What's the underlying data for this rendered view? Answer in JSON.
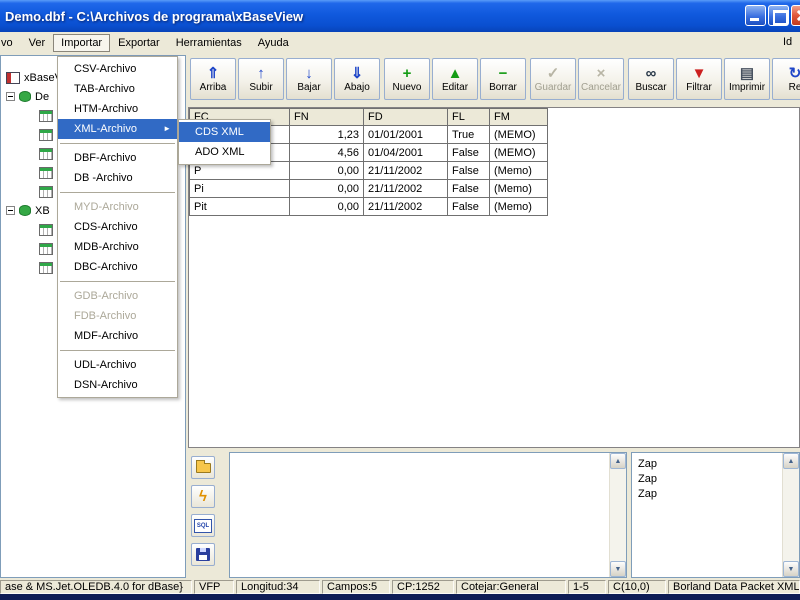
{
  "window": {
    "title": "Demo.dbf - C:\\Archivos de programa\\xBaseView"
  },
  "menubar": {
    "archivo_cut": "vo",
    "ver": "Ver",
    "importar": "Importar",
    "exportar": "Exportar",
    "herramientas": "Herramientas",
    "ayuda": "Ayuda",
    "right_cut": "Id"
  },
  "import_menu": {
    "items": [
      {
        "label": "CSV-Archivo"
      },
      {
        "label": "TAB-Archivo"
      },
      {
        "label": "HTM-Archivo"
      },
      {
        "label": "XML-Archivo"
      },
      {
        "label": "DBF-Archivo"
      },
      {
        "label": "DB -Archivo"
      },
      {
        "label": "MYD-Archivo"
      },
      {
        "label": "CDS-Archivo"
      },
      {
        "label": "MDB-Archivo"
      },
      {
        "label": "DBC-Archivo"
      },
      {
        "label": "GDB-Archivo"
      },
      {
        "label": "FDB-Archivo"
      },
      {
        "label": "MDF-Archivo"
      },
      {
        "label": "UDL-Archivo"
      },
      {
        "label": "DSN-Archivo"
      }
    ],
    "submenu_arrow": "►",
    "xml_submenu": [
      {
        "label": "CDS XML"
      },
      {
        "label": "ADO XML"
      }
    ]
  },
  "tree": {
    "root": "xBaseV",
    "node_demo": "De",
    "node_xb": "XB"
  },
  "toolbar": {
    "buttons": [
      {
        "label": "Arriba",
        "icon": "⇑"
      },
      {
        "label": "Subir",
        "icon": "↑"
      },
      {
        "label": "Bajar",
        "icon": "↓"
      },
      {
        "label": "Abajo",
        "icon": "⇓"
      },
      {
        "label": "Nuevo",
        "icon": "+"
      },
      {
        "label": "Editar",
        "icon": "▲"
      },
      {
        "label": "Borrar",
        "icon": "−"
      },
      {
        "label": "Guardar",
        "icon": "✓"
      },
      {
        "label": "Cancelar",
        "icon": "×"
      },
      {
        "label": "Buscar",
        "icon": "∞"
      },
      {
        "label": "Filtrar",
        "icon": "▼"
      },
      {
        "label": "Imprimir",
        "icon": "▤"
      },
      {
        "label": "Re",
        "icon": "↻"
      }
    ]
  },
  "grid": {
    "headers": [
      "FC",
      "FN",
      "FD",
      "FL",
      "FM"
    ],
    "rows": [
      [
        "",
        "1,23",
        "01/01/2001",
        "True",
        "(MEMO)"
      ],
      [
        "",
        "4,56",
        "01/04/2001",
        "False",
        "(MEMO)"
      ],
      [
        "P",
        "0,00",
        "21/11/2002",
        "False",
        "(Memo)"
      ],
      [
        "Pi",
        "0,00",
        "21/11/2002",
        "False",
        "(Memo)"
      ],
      [
        "Pit",
        "0,00",
        "21/11/2002",
        "False",
        "(Memo)"
      ]
    ]
  },
  "side": {
    "bolt": "ϟ",
    "sql": "SQL"
  },
  "scrollbar": {
    "up": "▲",
    "down": "▼"
  },
  "memo_panel": {
    "lines": [
      "Zap",
      "Zap",
      "Zap"
    ]
  },
  "statusbar": {
    "segments": [
      "ase & MS.Jet.OLEDB.4.0 for dBase}",
      "VFP",
      "Longitud:34",
      "Campos:5",
      "CP:1252",
      "Cotejar:General",
      "1-5",
      "C(10,0)",
      "Borland Data Packet XML"
    ]
  }
}
